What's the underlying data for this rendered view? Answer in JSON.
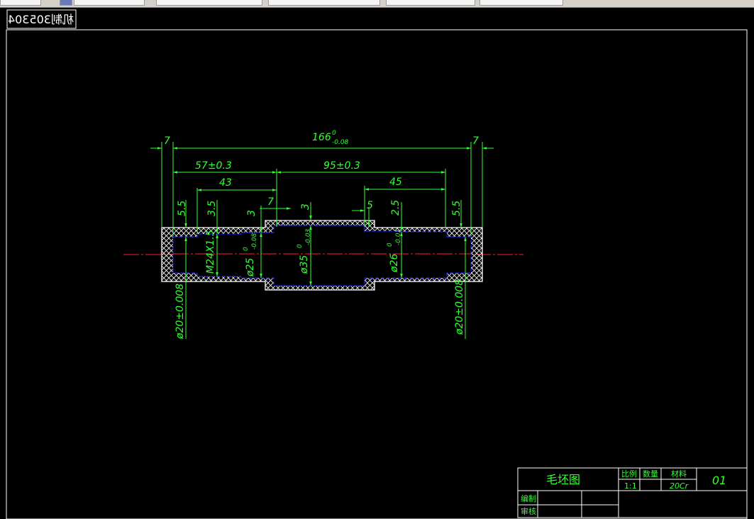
{
  "toolbar": {
    "segments": [
      "",
      "",
      "",
      "",
      "",
      "",
      ""
    ]
  },
  "stamp": {
    "text": "机制305304"
  },
  "dimensions": {
    "overall": "166",
    "overall_sup": "0",
    "overall_sub": "-0.08",
    "left_end": "7",
    "right_end": "7",
    "d57": "57±0.3",
    "d95": "95±0.3",
    "d43": "43",
    "d45": "45",
    "d7b": "7",
    "d3a": "3",
    "d3b": "3",
    "d5": "5",
    "d25": "2.5",
    "d55a": "5.5",
    "d35a": "3.5",
    "d55b": "5.5",
    "thread": "M24X1.5",
    "phi25": "ø25",
    "phi25_sup": "0",
    "phi25_sub": "-0.08",
    "phi35": "ø35",
    "phi35_sup": "0",
    "phi35_sub": "-0.03",
    "phi26": "ø26",
    "phi26_sup": "0",
    "phi26_sub": "-0.01",
    "phi20_left": "ø20±0.008",
    "phi20_right": "ø20±0.008"
  },
  "title_block": {
    "drawing_name": "毛坯图",
    "scale_label": "比例",
    "qty_label": "数量",
    "material_label": "材料",
    "scale_value": "1:1",
    "qty_value": "",
    "material_value": "20Cr",
    "drawing_no": "01",
    "drafter_label": "编制",
    "checker_label": "审核"
  },
  "colors": {
    "dimension": "#33ff33",
    "outline": "#ffffff",
    "centerline": "#ff2020",
    "hidden": "#2222ff",
    "background": "#000000"
  }
}
